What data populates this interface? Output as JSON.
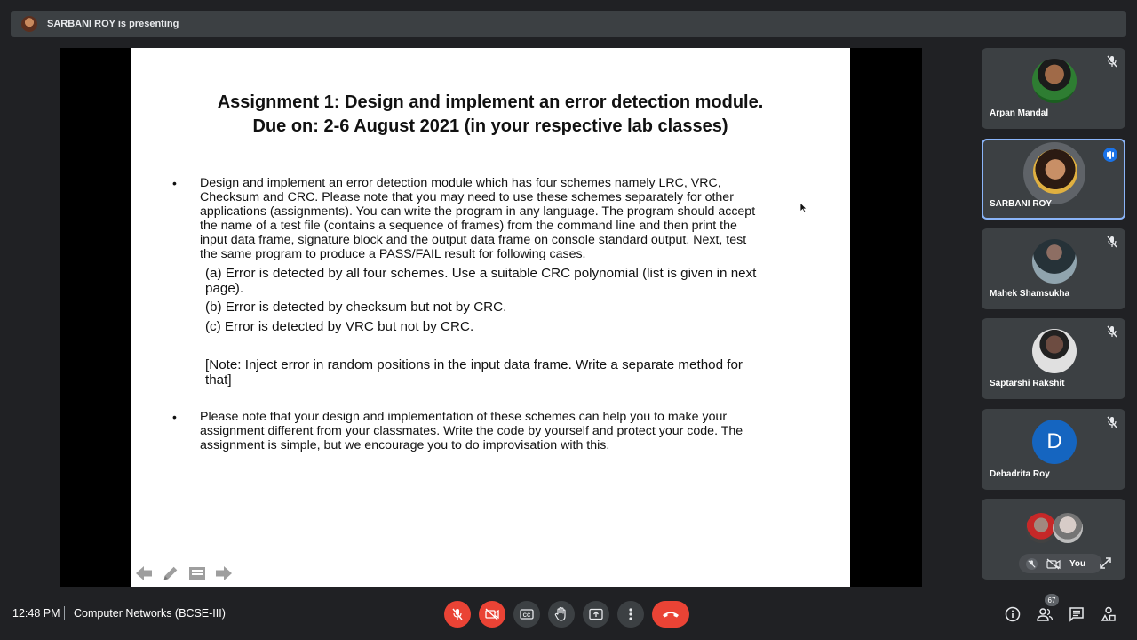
{
  "presenting_bar": {
    "text": "SARBANI ROY is presenting"
  },
  "slide": {
    "title_line1": "Assignment 1:  Design and implement an error detection module.",
    "title_line2": "Due on: 2-6 August 2021 (in your respective lab classes)",
    "bullet1": [
      "Design and implement an error detection module which has four schemes namely LRC, VRC,",
      "Checksum and CRC.  Please note that you may need to use these schemes separately for other",
      "applications (assignments). You can write the program in any language. The program should accept",
      "the name of a test file (contains a sequence of frames) from the command line and then print the",
      "input data frame, signature block and the output data frame on console standard output. Next, test",
      "the same program to produce a PASS/FAIL result for following cases."
    ],
    "case_a_line1": "(a) Error is detected by all four schemes. Use a suitable CRC polynomial (list is given in next",
    "case_a_line2": "page).",
    "case_b": "(b) Error is detected by checksum but not by CRC.",
    "case_c": "(c) Error is detected by VRC but not by CRC.",
    "note_line1": "[Note: Inject error in random positions in the input data frame. Write a separate method for",
    "note_line2": "that]",
    "bullet2": [
      "Please note that your design and implementation of these schemes can help you to make your",
      "assignment different from your classmates. Write the code by yourself and protect your code. The",
      "assignment is simple, but we encourage you to do improvisation with this."
    ],
    "bullet_char": "•"
  },
  "slide_tools": [
    "prev-arrow-icon",
    "pen-icon",
    "menu-icon",
    "next-arrow-icon"
  ],
  "participants": [
    {
      "name": "Arpan Mandal",
      "muted": true,
      "avatar": "photo"
    },
    {
      "name": "SARBANI ROY",
      "muted": false,
      "speaking": true,
      "avatar": "photo"
    },
    {
      "name": "Mahek Shamsukha",
      "muted": true,
      "avatar": "photo"
    },
    {
      "name": "Saptarshi Rakshit",
      "muted": true,
      "avatar": "photo"
    },
    {
      "name": "Debadrita Roy",
      "muted": true,
      "avatar": "letter",
      "letter": "D",
      "color": "#1565c0"
    }
  ],
  "self_tile": {
    "label": "You"
  },
  "footer": {
    "time": "12:48 PM",
    "meeting": "Computer Networks (BCSE-III)",
    "people_count": "67"
  },
  "colors": {
    "background": "#202124",
    "tile": "#3c4043",
    "danger": "#ea4335",
    "accent": "#8ab4f8"
  }
}
